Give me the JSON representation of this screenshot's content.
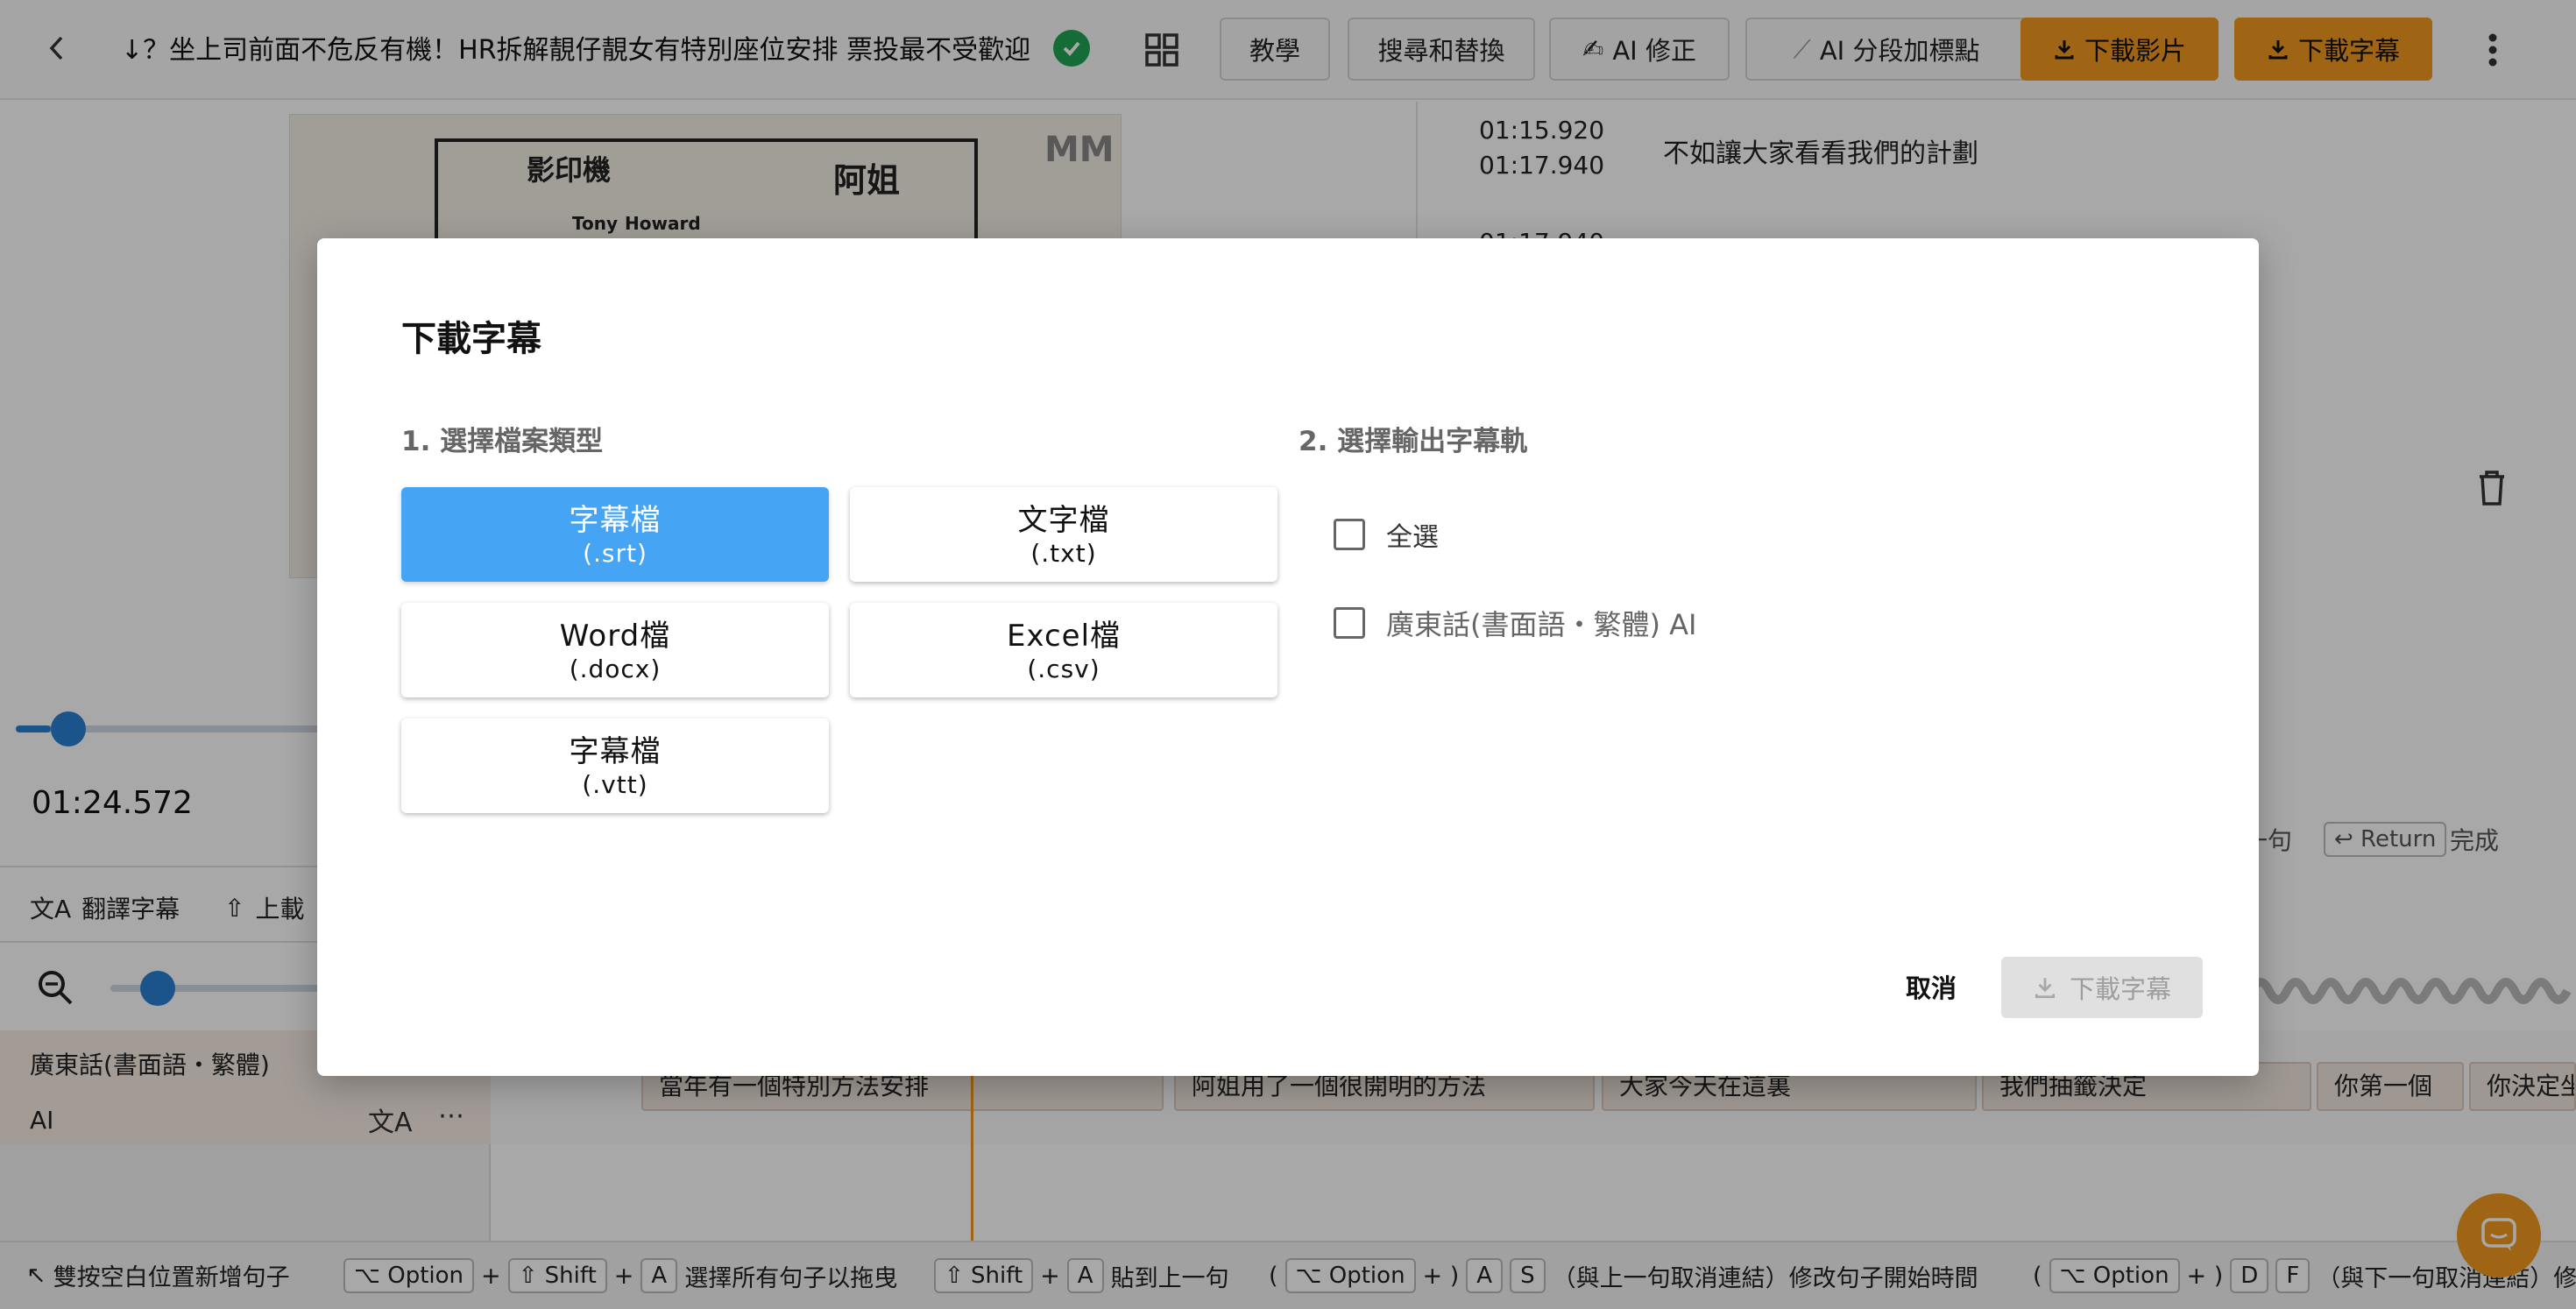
{
  "topbar": {
    "title": "↓？坐上司前面不危反有機！HR拆解靚仔靚女有特別座位安排 票投最不受歡迎",
    "buttons": {
      "tutorial": "教學",
      "search_replace": "搜尋和替換",
      "ai_fix": "AI 修正",
      "ai_segment": "AI 分段加標點",
      "download_video": "下載影片",
      "download_subtitle": "下載字幕"
    }
  },
  "player": {
    "sketch_labels": [
      "影印機",
      "阿姐",
      "Tony",
      "Howard"
    ],
    "logo_text": "MM",
    "timecode": "01:24.572",
    "progress": 0.1
  },
  "tools": {
    "translate": "翻譯字幕",
    "upload": "上載"
  },
  "track": {
    "name": "廣東話(書面語・繁體)",
    "sub": "AI"
  },
  "timeline": {
    "segments": [
      "當年有一個特別方法安排",
      "阿姐用了一個很開明的方法",
      "大家今天在這裏",
      "我們抽籤決定",
      "你第一個",
      "你決定坐"
    ]
  },
  "subtitles": {
    "start": "01:15.920",
    "end": "01:17.940",
    "text": "不如讓大家看看我們的計劃",
    "next_start": "01:17.940"
  },
  "right_hints": {
    "prev": "一句",
    "return_key": "↩ Return",
    "done": "完成"
  },
  "status_hints": {
    "add_sentence": "雙按空白位置新增句子",
    "option_key": "⌥ Option",
    "shift_key": "⇧ Shift",
    "a_key": "A",
    "s_key": "S",
    "d_key": "D",
    "f_key": "F",
    "select_all_drag": "選擇所有句子以拖曳",
    "paste_prev": "貼到上一句",
    "modify_start": "（與上一句取消連結）修改句子開始時間",
    "modify_end": "（與下一句取消連結）修"
  },
  "modal": {
    "title": "下載字幕",
    "step1": "1. 選擇檔案類型",
    "step2": "2. 選擇輸出字幕軌",
    "formats": [
      {
        "name": "字幕檔",
        "ext": "(.srt)"
      },
      {
        "name": "文字檔",
        "ext": "(.txt)"
      },
      {
        "name": "Word檔",
        "ext": "(.docx)"
      },
      {
        "name": "Excel檔",
        "ext": "(.csv)"
      },
      {
        "name": "字幕檔",
        "ext": "(.vtt)"
      }
    ],
    "select_all": "全選",
    "track_option": "廣東話(書面語・繁體) AI",
    "cancel": "取消",
    "download": "下載字幕"
  },
  "colors": {
    "accent_orange": "#f29a1f",
    "selected_blue": "#46a4f4",
    "success_green": "#21a453"
  }
}
